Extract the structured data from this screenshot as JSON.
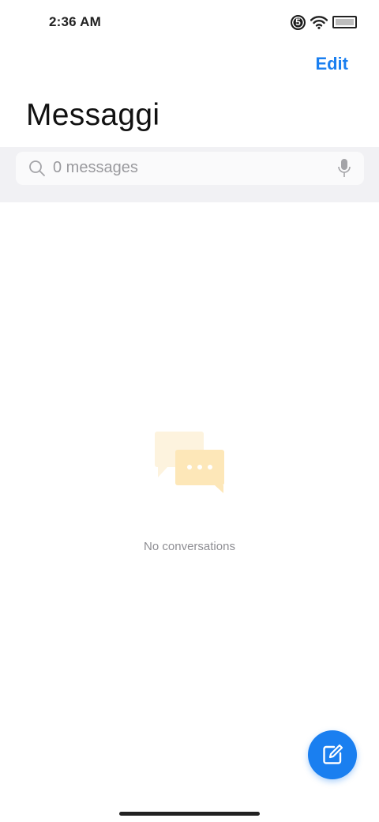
{
  "status_bar": {
    "time": "2:36 AM",
    "notification_count": "5",
    "icons": [
      "notification-badge-icon",
      "wifi-icon",
      "battery-icon"
    ]
  },
  "header": {
    "edit_label": "Edit",
    "title": "Messaggi"
  },
  "search": {
    "placeholder": "0 messages",
    "icon": "search-icon",
    "mic_icon": "microphone-icon"
  },
  "empty_state": {
    "illustration": "chat-bubbles-icon",
    "text": "No conversations"
  },
  "fab": {
    "icon": "compose-icon"
  },
  "colors": {
    "accent": "#1a7ff0",
    "search_band": "#f1f1f4",
    "illustration_back": "#fdf2dc",
    "illustration_front": "#fde6b6"
  }
}
